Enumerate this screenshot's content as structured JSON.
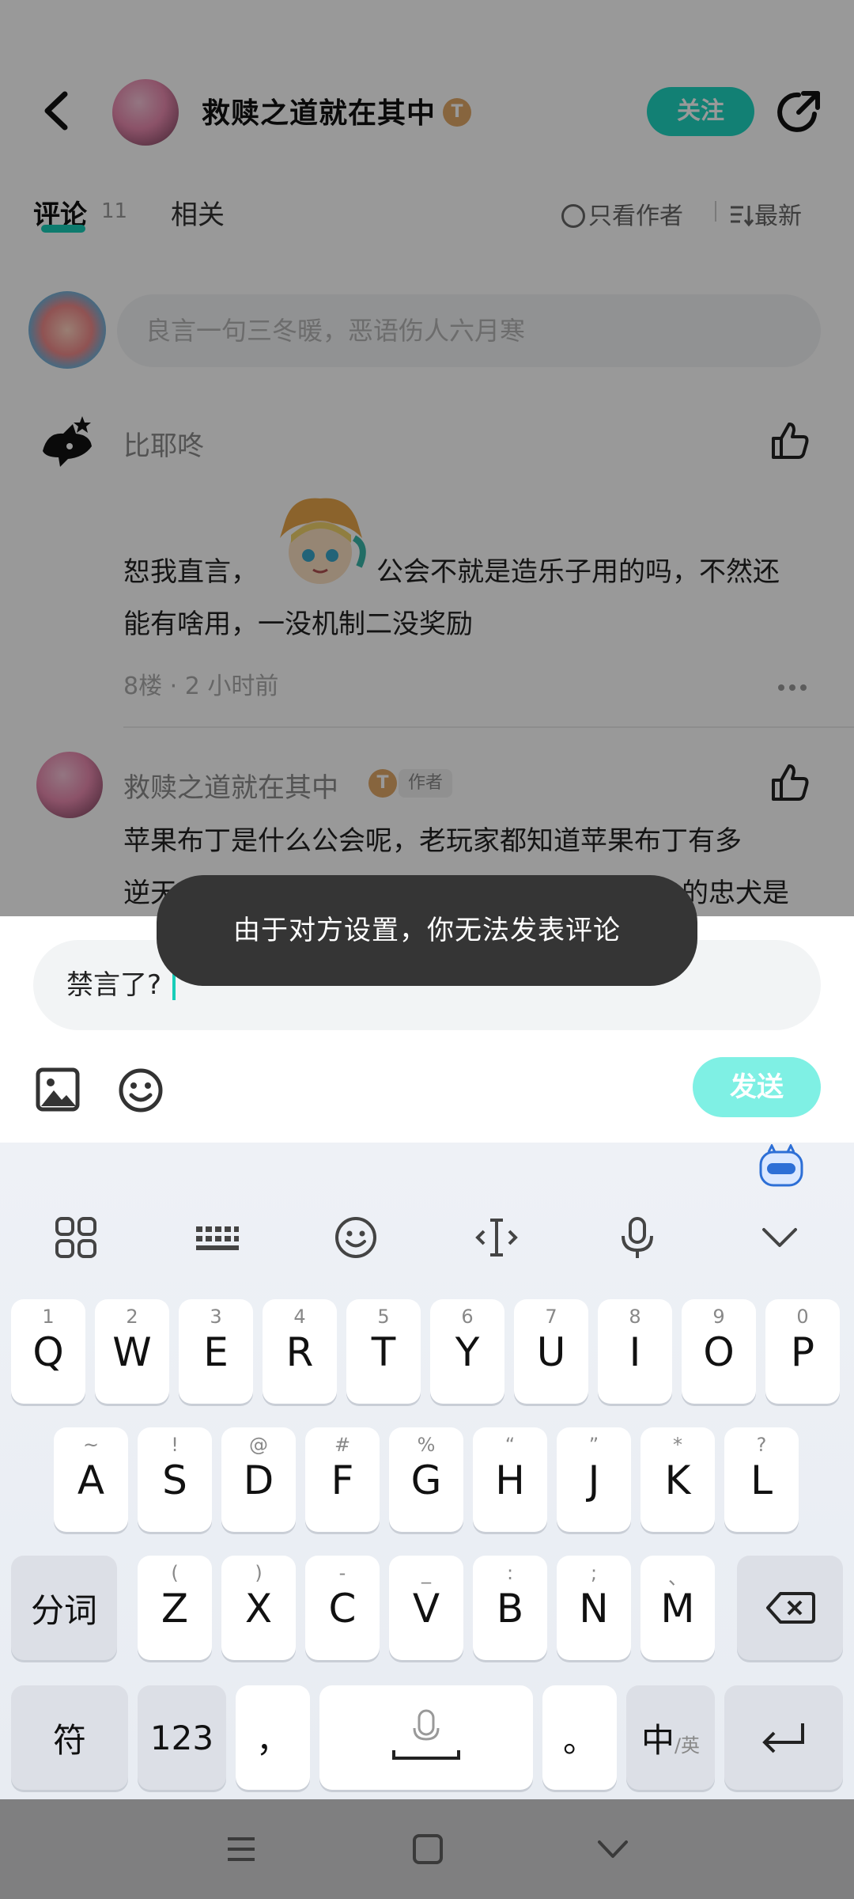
{
  "header": {
    "title": "救赎之道就在其中",
    "level_badge": "T",
    "follow_label": "关注"
  },
  "tabs": {
    "comments_label": "评论",
    "comments_count": "11",
    "related_label": "相关",
    "only_author_label": "只看作者",
    "sort_label": "最新"
  },
  "comment_box": {
    "placeholder": "良言一句三冬暖，恶语伤人六月寒"
  },
  "comments": [
    {
      "author": "比耶咚",
      "text_line1": "恕我直言，",
      "text_line1_after": "公会不就是造乐子用的吗，不然还",
      "text_line2": "能有啥用，一没机制二没奖励",
      "meta": "8楼 · 2 小时前"
    },
    {
      "author": "救赎之道就在其中",
      "level_badge": "T",
      "author_tag": "作者",
      "text_line1": "苹果布丁是什么公会呢，老玩家都知道苹果布丁有多",
      "text_line2_start": "逆天",
      "text_line2_end": "的忠犬是"
    }
  ],
  "reply": {
    "input_value": "禁言了?",
    "send_label": "发送"
  },
  "toast": {
    "message": "由于对方设置，你无法发表评论"
  },
  "keyboard": {
    "row1": [
      {
        "main": "Q",
        "sub": "1"
      },
      {
        "main": "W",
        "sub": "2"
      },
      {
        "main": "E",
        "sub": "3"
      },
      {
        "main": "R",
        "sub": "4"
      },
      {
        "main": "T",
        "sub": "5"
      },
      {
        "main": "Y",
        "sub": "6"
      },
      {
        "main": "U",
        "sub": "7"
      },
      {
        "main": "I",
        "sub": "8"
      },
      {
        "main": "O",
        "sub": "9"
      },
      {
        "main": "P",
        "sub": "0"
      }
    ],
    "row2": [
      {
        "main": "A",
        "sub": "~"
      },
      {
        "main": "S",
        "sub": "!"
      },
      {
        "main": "D",
        "sub": "@"
      },
      {
        "main": "F",
        "sub": "#"
      },
      {
        "main": "G",
        "sub": "%"
      },
      {
        "main": "H",
        "sub": "“"
      },
      {
        "main": "J",
        "sub": "”"
      },
      {
        "main": "K",
        "sub": "*"
      },
      {
        "main": "L",
        "sub": "?"
      }
    ],
    "row3": [
      {
        "main": "Z",
        "sub": "("
      },
      {
        "main": "X",
        "sub": ")"
      },
      {
        "main": "C",
        "sub": "-"
      },
      {
        "main": "V",
        "sub": "_"
      },
      {
        "main": "B",
        "sub": ":"
      },
      {
        "main": "N",
        "sub": ";"
      },
      {
        "main": "M",
        "sub": "、"
      }
    ],
    "segment_label": "分词",
    "symbols_label": "符",
    "numbers_label": "123",
    "comma_label": "，",
    "period_label": "。",
    "lang_main": "中",
    "lang_sub": "/英"
  },
  "colors": {
    "accent": "#1fd6c2",
    "send_disabled": "#7ff0e4",
    "toast_bg": "#353535",
    "navbar_bg": "#7f7f80"
  }
}
